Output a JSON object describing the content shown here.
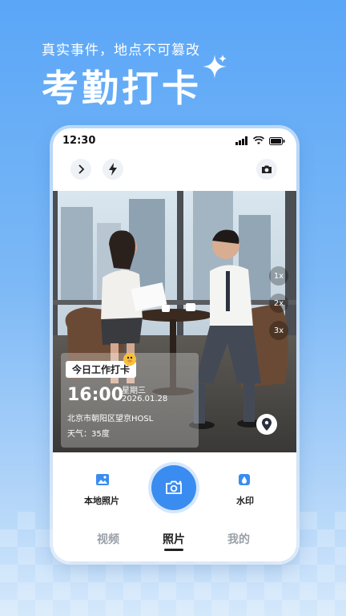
{
  "promo": {
    "subtitle": "真实事件，地点不可篡改",
    "headline": "考勤打卡"
  },
  "status_bar": {
    "time": "12:30"
  },
  "watermark": {
    "title": "今日工作打卡",
    "time": "16:00",
    "weekday": "星期三",
    "date": "2026.01.28",
    "location": "北京市朝阳区望京HOSL",
    "weather": "天气：35度"
  },
  "zoom_levels": [
    "1x",
    "2x",
    "3x"
  ],
  "actions": {
    "local_photo": "本地照片",
    "watermark": "水印"
  },
  "tabs": [
    {
      "label": "视频",
      "active": false
    },
    {
      "label": "照片",
      "active": true
    },
    {
      "label": "我的",
      "active": false
    }
  ],
  "colors": {
    "accent": "#3a8cf0",
    "bg_top": "#5aa6f7"
  }
}
